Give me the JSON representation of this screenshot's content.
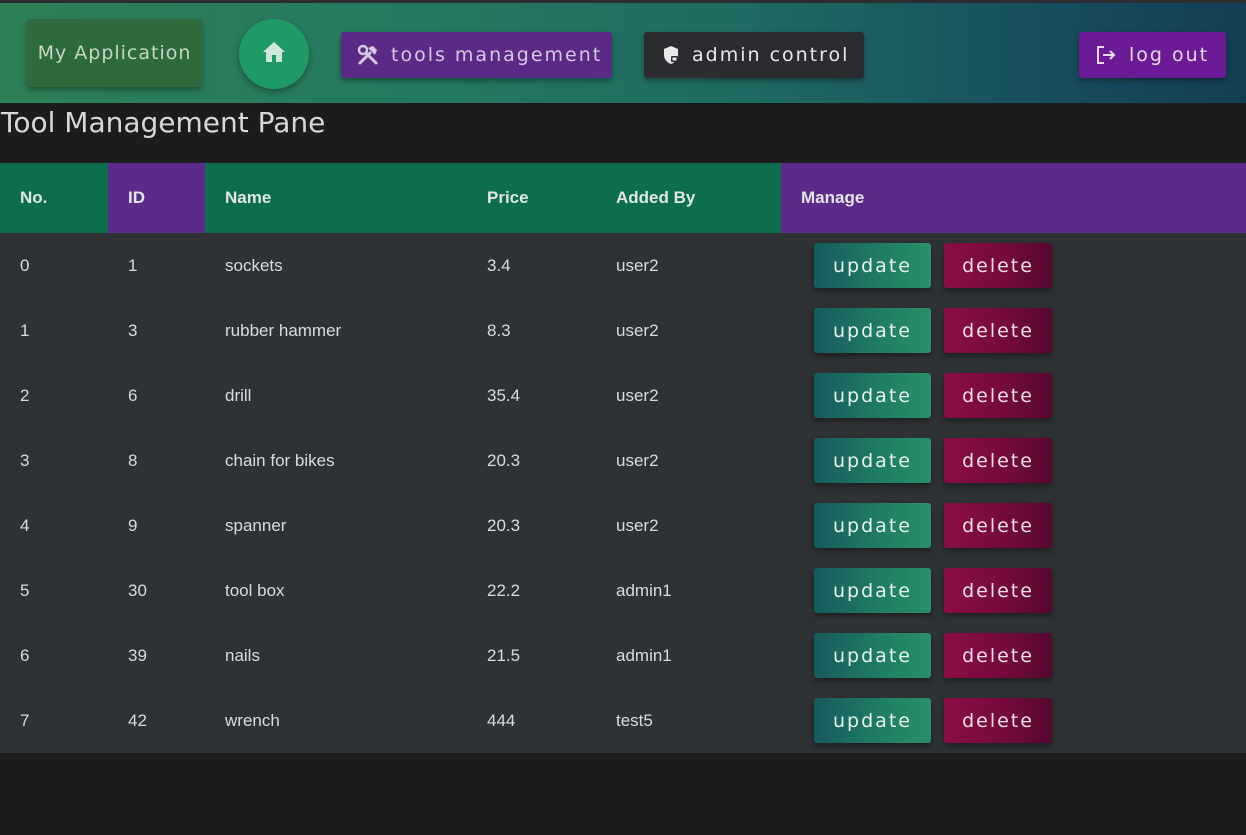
{
  "nav": {
    "brand": "My Application",
    "home_icon": "home-icon",
    "tools_label": "tools management",
    "tools_icon": "hammer-wrench-icon",
    "admin_label": "admin control",
    "admin_icon": "shield-lock-icon",
    "logout_label": "log out",
    "logout_icon": "logout-icon"
  },
  "page": {
    "title": "Tool Management Pane"
  },
  "table": {
    "headers": {
      "no": "No.",
      "id": "ID",
      "name": "Name",
      "price": "Price",
      "added_by": "Added By",
      "manage": "Manage"
    },
    "update_label": "update",
    "delete_label": "delete",
    "rows": [
      {
        "no": "0",
        "id": "1",
        "name": "sockets",
        "price": "3.4",
        "added_by": "user2"
      },
      {
        "no": "1",
        "id": "3",
        "name": "rubber hammer",
        "price": "8.3",
        "added_by": "user2"
      },
      {
        "no": "2",
        "id": "6",
        "name": "drill",
        "price": "35.4",
        "added_by": "user2"
      },
      {
        "no": "3",
        "id": "8",
        "name": "chain for bikes",
        "price": "20.3",
        "added_by": "user2"
      },
      {
        "no": "4",
        "id": "9",
        "name": "spanner",
        "price": "20.3",
        "added_by": "user2"
      },
      {
        "no": "5",
        "id": "30",
        "name": "tool box",
        "price": "22.2",
        "added_by": "admin1"
      },
      {
        "no": "6",
        "id": "39",
        "name": "nails",
        "price": "21.5",
        "added_by": "admin1"
      },
      {
        "no": "7",
        "id": "42",
        "name": "wrench",
        "price": "444",
        "added_by": "test5"
      }
    ]
  },
  "colors": {
    "header_green": "#0c6e4c",
    "header_purple": "#5b2a8a",
    "update_button": "#1f7f65",
    "delete_button": "#730a3d",
    "tools_button": "#5b2a86",
    "logout_button": "#6a1b95"
  }
}
